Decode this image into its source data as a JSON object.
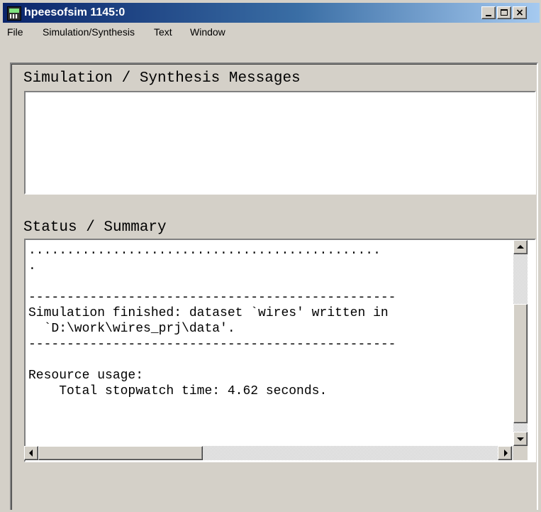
{
  "window": {
    "title": "hpeesofsim 1145:0"
  },
  "titlebar_buttons": {
    "minimize": "minimize-icon",
    "maximize": "maximize-icon",
    "close": "close-icon"
  },
  "menu": {
    "items": [
      "File",
      "Simulation/Synthesis",
      "Text",
      "Window"
    ]
  },
  "messages_section": {
    "label": "Simulation / Synthesis Messages",
    "content": ""
  },
  "status_section": {
    "label": "Status / Summary",
    "text": "..............................................\n.\n\n------------------------------------------------\nSimulation finished: dataset `wires' written in\n  `D:\\work\\wires_prj\\data'.\n------------------------------------------------\n\nResource usage:\n    Total stopwatch time: 4.62 seconds."
  },
  "colors": {
    "titlebar_start": "#0a246a",
    "titlebar_end": "#a6caf0",
    "face": "#d4d0c8"
  }
}
